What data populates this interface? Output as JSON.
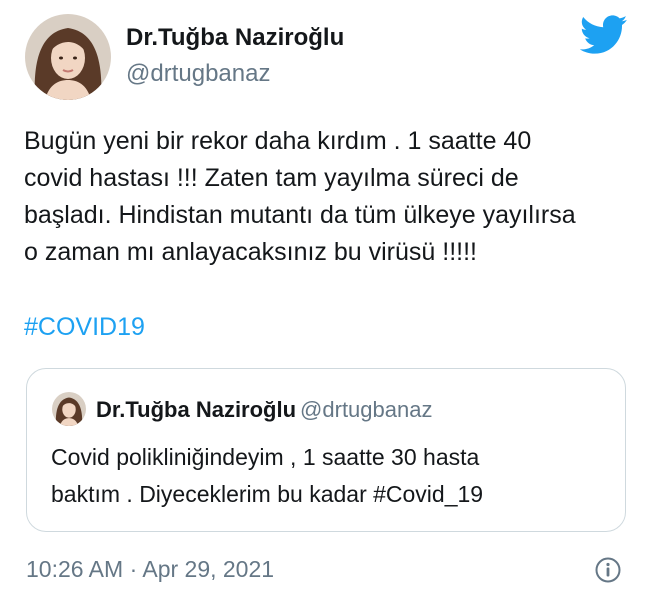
{
  "author": {
    "display_name": "Dr.Tuğba Naziroğlu",
    "handle": "@drtugbanaz",
    "avatar": "profile-photo"
  },
  "tweet": {
    "text_lines": [
      "Bugün yeni bir rekor daha kırdım . 1 saatte 40",
      "covid hastası !!! Zaten tam yayılma süreci de",
      "başladı. Hindistan mutantı da tüm ülkeye yayılırsa",
      "o zaman mı anlayacaksınız bu virüsü !!!!!"
    ],
    "hashtag": "#COVID19"
  },
  "quoted_tweet": {
    "display_name": "Dr.Tuğba Naziroğlu",
    "handle": "@drtugbanaz",
    "text_lines": [
      "Covid polikliniğindeyim , 1 saatte 30 hasta",
      "baktım . Diyeceklerim bu kadar #Covid_19"
    ]
  },
  "timestamp": "10:26 AM · Apr 29, 2021",
  "icons": {
    "brand": "twitter-bird-icon",
    "info": "info-icon"
  },
  "colors": {
    "brand_blue": "#1da1f2",
    "text": "#14171a",
    "muted": "#657786",
    "border": "#cfd9de"
  }
}
